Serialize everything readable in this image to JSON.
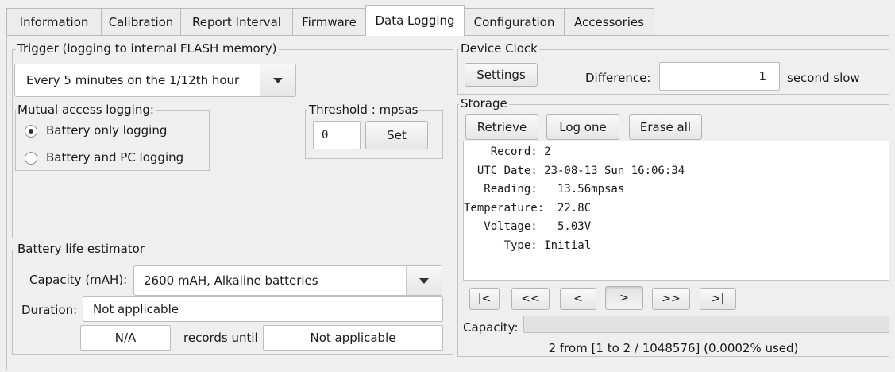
{
  "tabs": [
    "Information",
    "Calibration",
    "Report Interval",
    "Firmware",
    "Data Logging",
    "Configuration",
    "Accessories"
  ],
  "active_tab": "Data Logging",
  "trigger": {
    "title": "Trigger (logging to internal FLASH memory)",
    "selected": "Every 5 minutes on the 1/12th hour"
  },
  "mutual_access": {
    "title": "Mutual access logging:",
    "options": [
      "Battery only logging",
      "Battery and PC logging"
    ],
    "selected_index": 0
  },
  "threshold": {
    "title": "Threshold : mpsas",
    "value": "0",
    "set_label": "Set"
  },
  "battery": {
    "title": "Battery life estimator",
    "capacity_label": "Capacity (mAH):",
    "capacity_value": "2600 mAH, Alkaline batteries",
    "duration_label": "Duration:",
    "duration_value": "Not applicable",
    "records_value": "N/A",
    "records_until_label": "records until",
    "until_value": "Not applicable"
  },
  "device_clock": {
    "title": "Device Clock",
    "settings_label": "Settings",
    "difference_label": "Difference:",
    "difference_value": "1",
    "difference_unit": "second slow"
  },
  "storage": {
    "title": "Storage",
    "retrieve_label": "Retrieve",
    "log_one_label": "Log one",
    "erase_all_label": "Erase all",
    "record_lines": [
      "    Record: 2",
      "  UTC Date: 23-08-13 Sun 16:06:34",
      "   Reading:   13.56mpsas",
      "Temperature:  22.8C",
      "   Voltage:   5.03V",
      "      Type: Initial"
    ],
    "nav": [
      "|<",
      "<<",
      "<",
      ">",
      ">>",
      ">|"
    ],
    "capacity_label": "Capacity:",
    "capacity_fraction": 2e-06,
    "status": "2 from [1 to 2 / 1048576] (0.0002% used)"
  }
}
